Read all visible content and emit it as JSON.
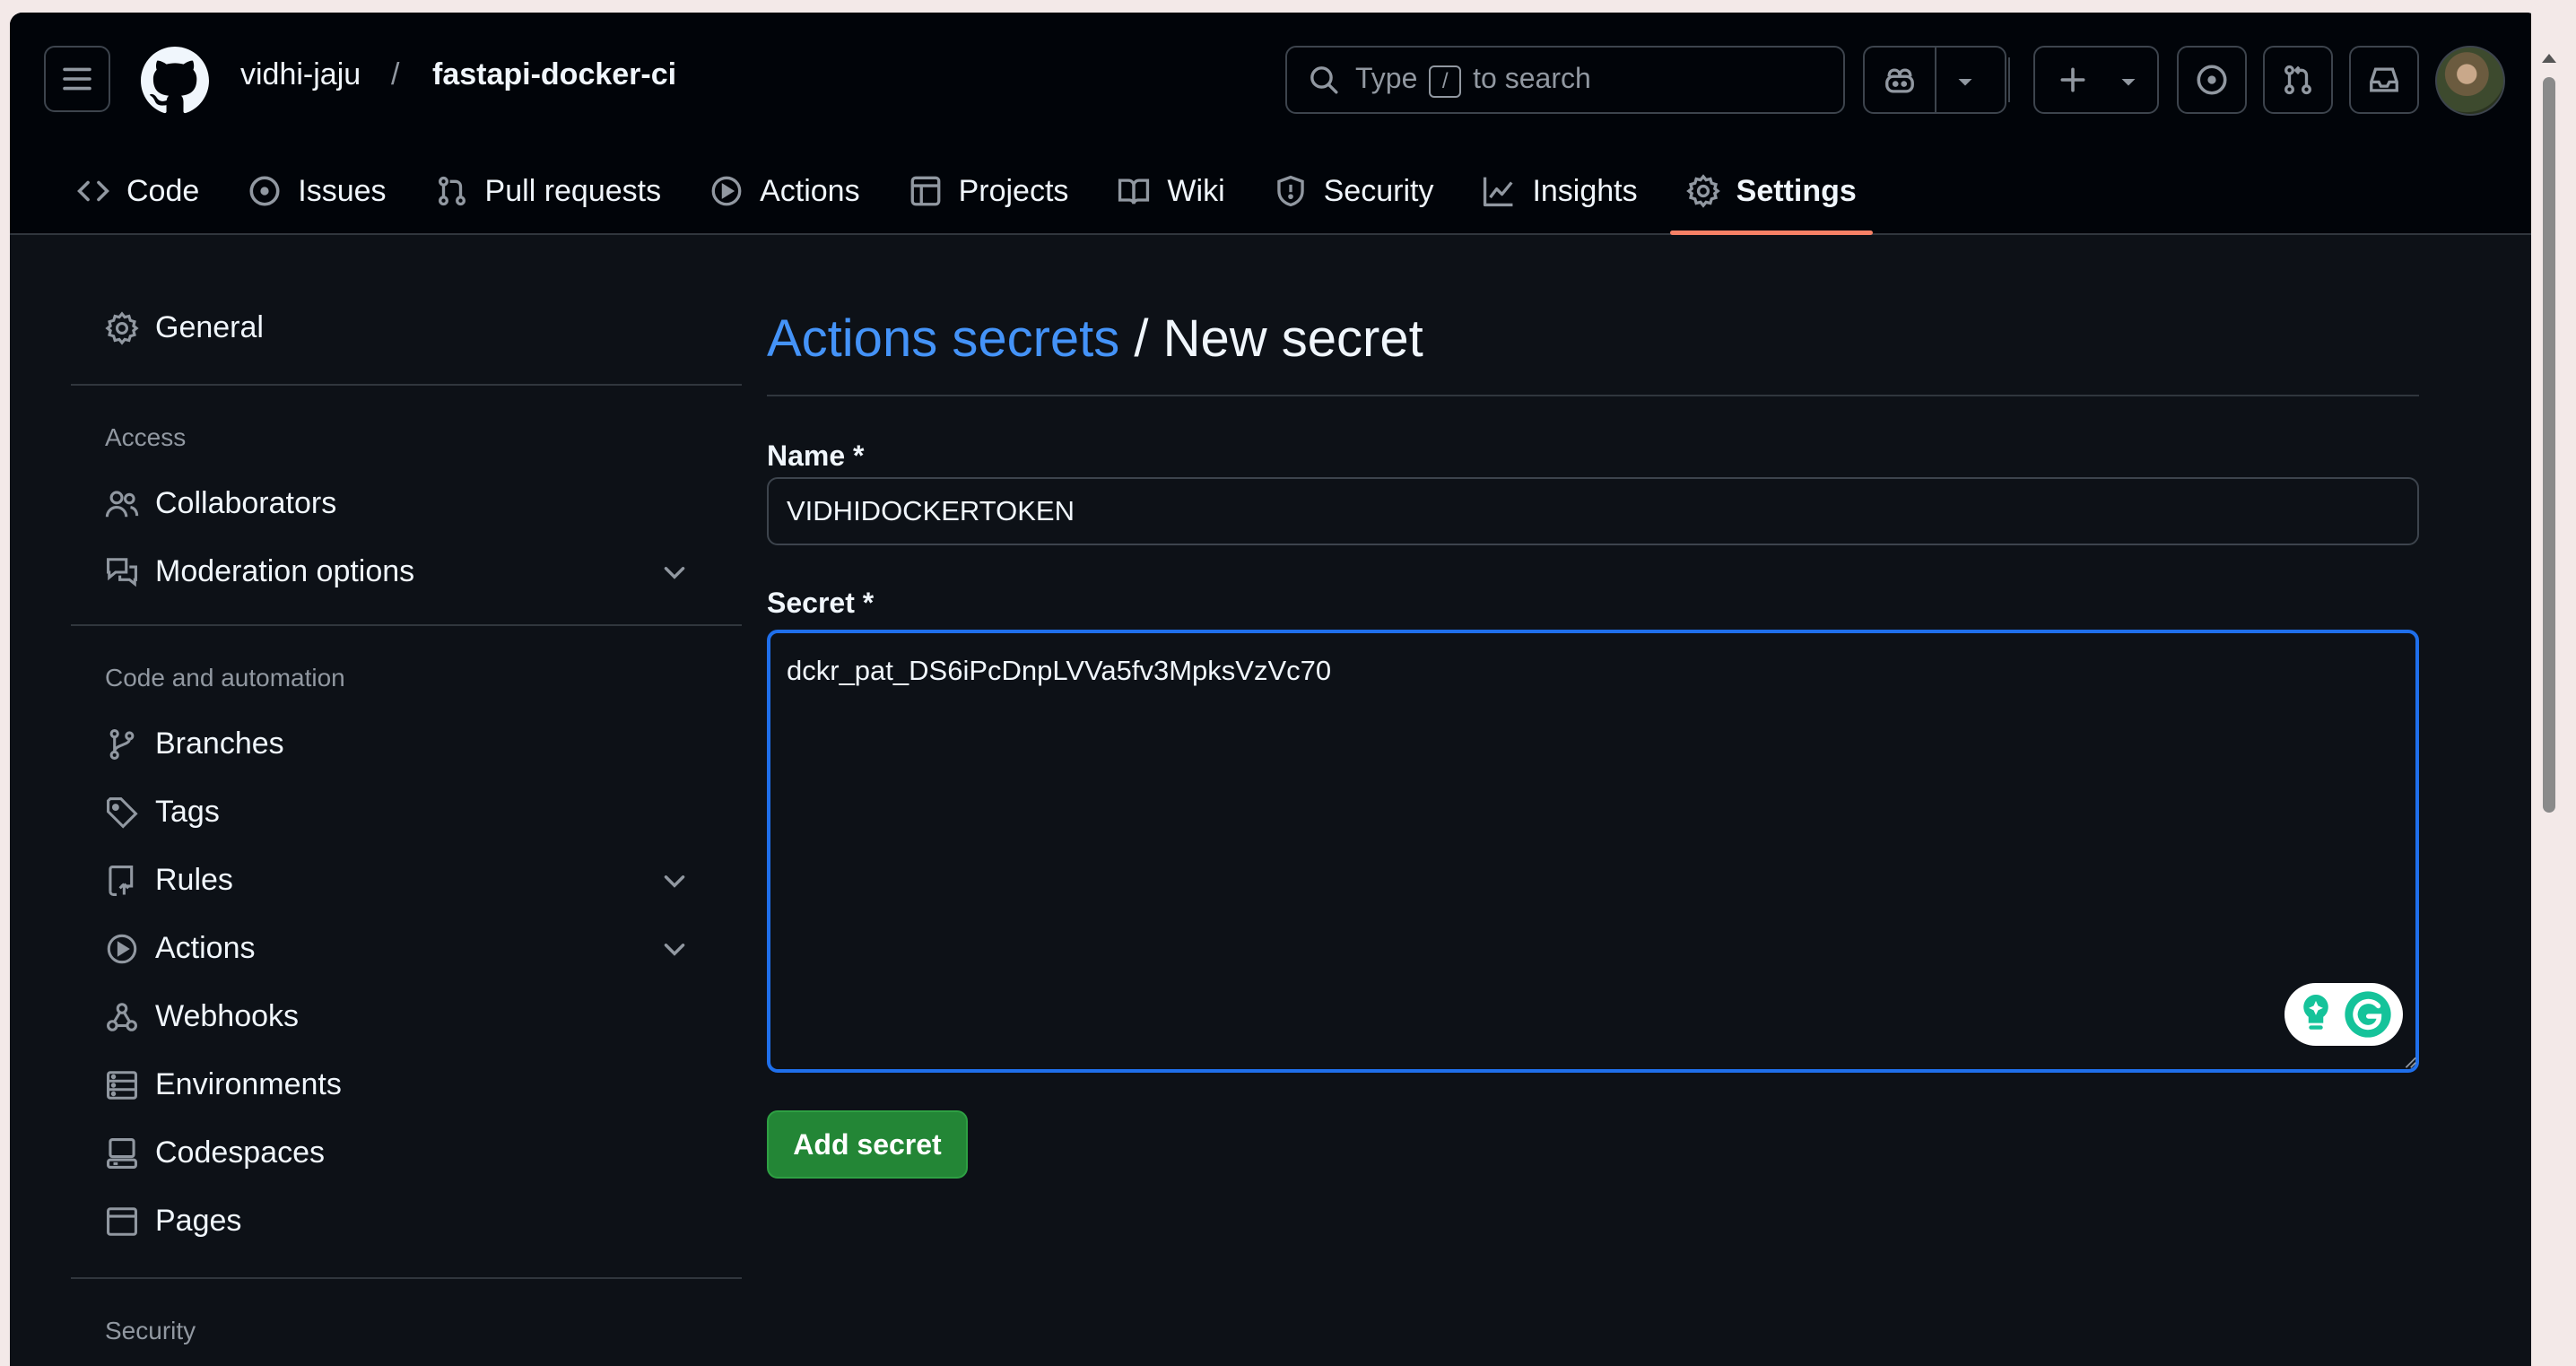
{
  "header": {
    "owner": "vidhi-jaju",
    "separator": "/",
    "repo": "fastapi-docker-ci",
    "search": {
      "prefix": "Type",
      "key": "/",
      "suffix": "to search"
    }
  },
  "tabs": [
    {
      "label": "Code",
      "icon": "code-icon"
    },
    {
      "label": "Issues",
      "icon": "issue-icon"
    },
    {
      "label": "Pull requests",
      "icon": "pull-request-icon"
    },
    {
      "label": "Actions",
      "icon": "play-icon"
    },
    {
      "label": "Projects",
      "icon": "table-icon"
    },
    {
      "label": "Wiki",
      "icon": "book-icon"
    },
    {
      "label": "Security",
      "icon": "shield-icon"
    },
    {
      "label": "Insights",
      "icon": "graph-icon"
    },
    {
      "label": "Settings",
      "icon": "gear-icon",
      "selected": true
    }
  ],
  "sidebar": {
    "general": "General",
    "access_heading": "Access",
    "collaborators": "Collaborators",
    "moderation": "Moderation options",
    "code_heading": "Code and automation",
    "branches": "Branches",
    "tags": "Tags",
    "rules": "Rules",
    "actions": "Actions",
    "webhooks": "Webhooks",
    "environments": "Environments",
    "codespaces": "Codespaces",
    "pages": "Pages",
    "security_heading": "Security"
  },
  "main": {
    "breadcrumb_link": "Actions secrets",
    "breadcrumb_rest": " / New secret",
    "name_label": "Name *",
    "name_value": "VIDHIDOCKERTOKEN",
    "secret_label": "Secret *",
    "secret_value": "dckr_pat_DS6iPcDnpLVVa5fv3MpksVzVc70",
    "add_button": "Add secret"
  },
  "colors": {
    "accent_link": "#4493f8",
    "primary_button": "#238636",
    "selected_tab_underline": "#f78166",
    "focus_border": "#1f6feb"
  }
}
